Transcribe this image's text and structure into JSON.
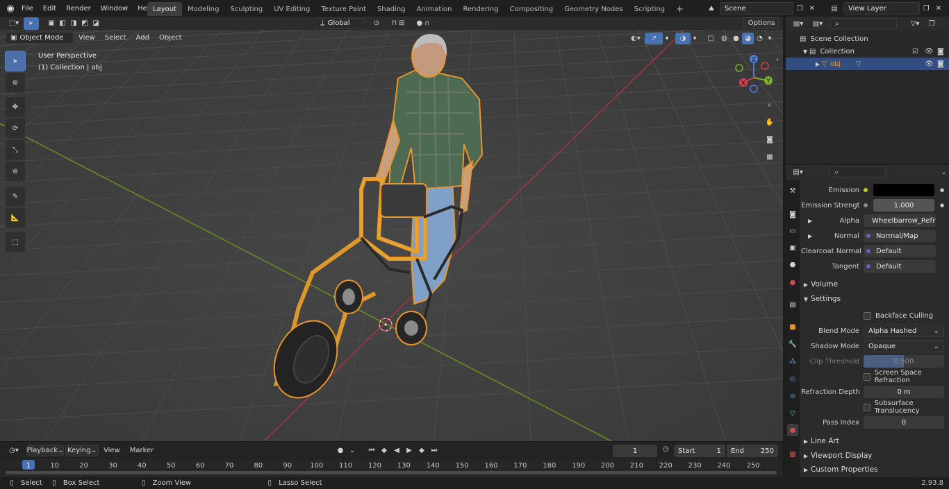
{
  "topbar": {
    "menus": [
      "File",
      "Edit",
      "Render",
      "Window",
      "Help"
    ],
    "workspaces": [
      "Layout",
      "Modeling",
      "Sculpting",
      "UV Editing",
      "Texture Paint",
      "Shading",
      "Animation",
      "Rendering",
      "Compositing",
      "Geometry Nodes",
      "Scripting"
    ],
    "active_workspace": "Layout",
    "scene_name": "Scene",
    "view_layer_name": "View Layer"
  },
  "viewport": {
    "mode": "Object Mode",
    "menus": [
      "View",
      "Select",
      "Add",
      "Object"
    ],
    "transform_orientation": "Global",
    "options_label": "Options",
    "overlay_title": "User Perspective",
    "overlay_subtitle": "(1) Collection | obj",
    "gizmo_axes": {
      "x": "X",
      "y": "Y",
      "z": "Z"
    }
  },
  "outliner": {
    "items": [
      {
        "label": "Scene Collection"
      },
      {
        "label": "Collection"
      },
      {
        "label": "obj"
      }
    ]
  },
  "properties": {
    "rows_top": [
      {
        "label": "Emission",
        "value": "",
        "dot": "#c7c62d",
        "swatch": "#000000"
      },
      {
        "label": "Emission Strengt",
        "value": "1.000",
        "dot": "#8a8a8a"
      },
      {
        "label": "Alpha",
        "value": "Wheelbarrow_Refra...",
        "dot": "#7b77b8",
        "expand": "▸"
      },
      {
        "label": "Normal",
        "value": "Normal/Map",
        "dot": "#6363c7",
        "expand": "▸"
      },
      {
        "label": "Clearcoat Normal",
        "value": "Default",
        "dot": "#6363c7"
      },
      {
        "label": "Tangent",
        "value": "Default",
        "dot": "#6363c7"
      }
    ],
    "volume_label": "Volume",
    "settings_label": "Settings",
    "backface_culling": "Backface Culling",
    "blend_mode_label": "Blend Mode",
    "blend_mode_value": "Alpha Hashed",
    "shadow_mode_label": "Shadow Mode",
    "shadow_mode_value": "Opaque",
    "clip_threshold_label": "Clip Threshold",
    "clip_threshold_value": "0.500",
    "screen_space_refraction": "Screen Space Refraction",
    "refraction_depth_label": "Refraction Depth",
    "refraction_depth_value": "0 m",
    "subsurface_translucency": "Subsurface Translucency",
    "pass_index_label": "Pass Index",
    "pass_index_value": "0",
    "line_art_label": "Line Art",
    "viewport_display_label": "Viewport Display",
    "custom_properties_label": "Custom Properties"
  },
  "timeline": {
    "menus": [
      "Playback",
      "Keying",
      "View",
      "Marker"
    ],
    "current_frame": "1",
    "start_label": "Start",
    "start_value": "1",
    "end_label": "End",
    "end_value": "250",
    "ticks": [
      "1",
      "10",
      "20",
      "30",
      "40",
      "50",
      "60",
      "70",
      "80",
      "90",
      "100",
      "110",
      "120",
      "130",
      "140",
      "150",
      "160",
      "170",
      "180",
      "190",
      "200",
      "210",
      "220",
      "230",
      "240",
      "250"
    ]
  },
  "statusbar": {
    "select": "Select",
    "box_select": "Box Select",
    "zoom_view": "Zoom View",
    "lasso_select": "Lasso Select",
    "version": "2.93.8"
  },
  "colors": {
    "accent": "#4772b3",
    "selection_outline": "#e8962a",
    "x_axis": "#a8343f",
    "y_axis": "#6b8f1f",
    "grid": "#4a4a4a"
  }
}
